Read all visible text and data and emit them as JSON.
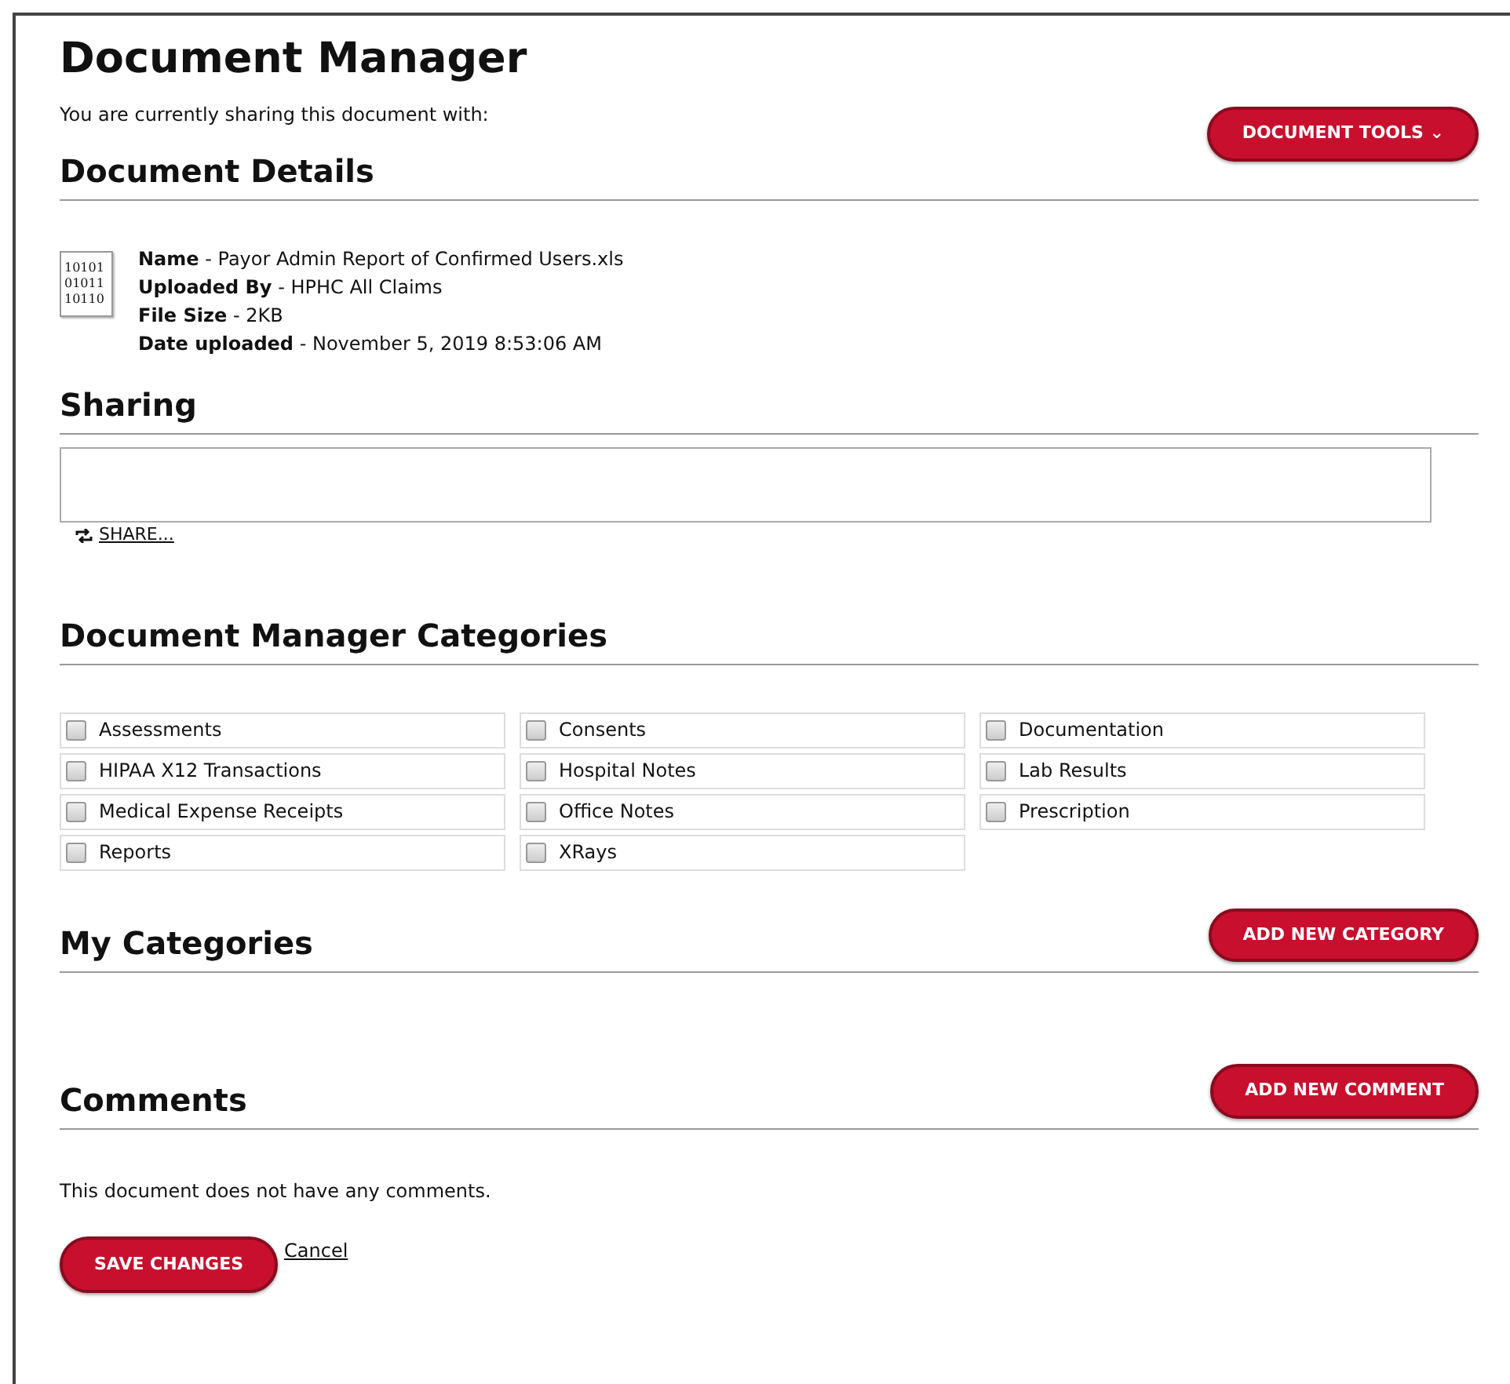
{
  "title": "Document Manager",
  "sharing_note": "You are currently sharing this document with:",
  "tools_button": {
    "label": "DOCUMENT TOOLS",
    "caret": "⌄"
  },
  "details": {
    "heading": "Document Details",
    "icon_text": [
      "10101",
      "01011",
      "10110"
    ],
    "lines": [
      "**Name** - Payor Admin Report of Confirmed Users.xls",
      "**Uploaded By** - HPHC All Claims",
      "**File Size** - 2KB",
      "**Date uploaded** - November 5, 2019 8:53:06 AM"
    ]
  },
  "sharing": {
    "heading": "Sharing",
    "share_link": "SHARE..."
  },
  "categories": {
    "heading": "Document Manager Categories",
    "items": [
      {
        "label": "Assessments",
        "checked": false
      },
      {
        "label": "Consents",
        "checked": false
      },
      {
        "label": "Documentation",
        "checked": false
      },
      {
        "label": "HIPAA X12 Transactions",
        "checked": false
      },
      {
        "label": "Hospital Notes",
        "checked": false
      },
      {
        "label": "Lab Results",
        "checked": false
      },
      {
        "label": "Medical Expense Receipts",
        "checked": false
      },
      {
        "label": "Office Notes",
        "checked": false
      },
      {
        "label": "Prescription",
        "checked": false
      },
      {
        "label": "Reports",
        "checked": false
      },
      {
        "label": "XRays",
        "checked": false
      }
    ]
  },
  "my_categories": {
    "heading": "My Categories",
    "button": "ADD NEW CATEGORY"
  },
  "comments": {
    "heading": "Comments",
    "button": "ADD NEW COMMENT",
    "empty_text": "This document does not have any comments."
  },
  "footer": {
    "save": "SAVE CHANGES",
    "cancel": "Cancel"
  }
}
